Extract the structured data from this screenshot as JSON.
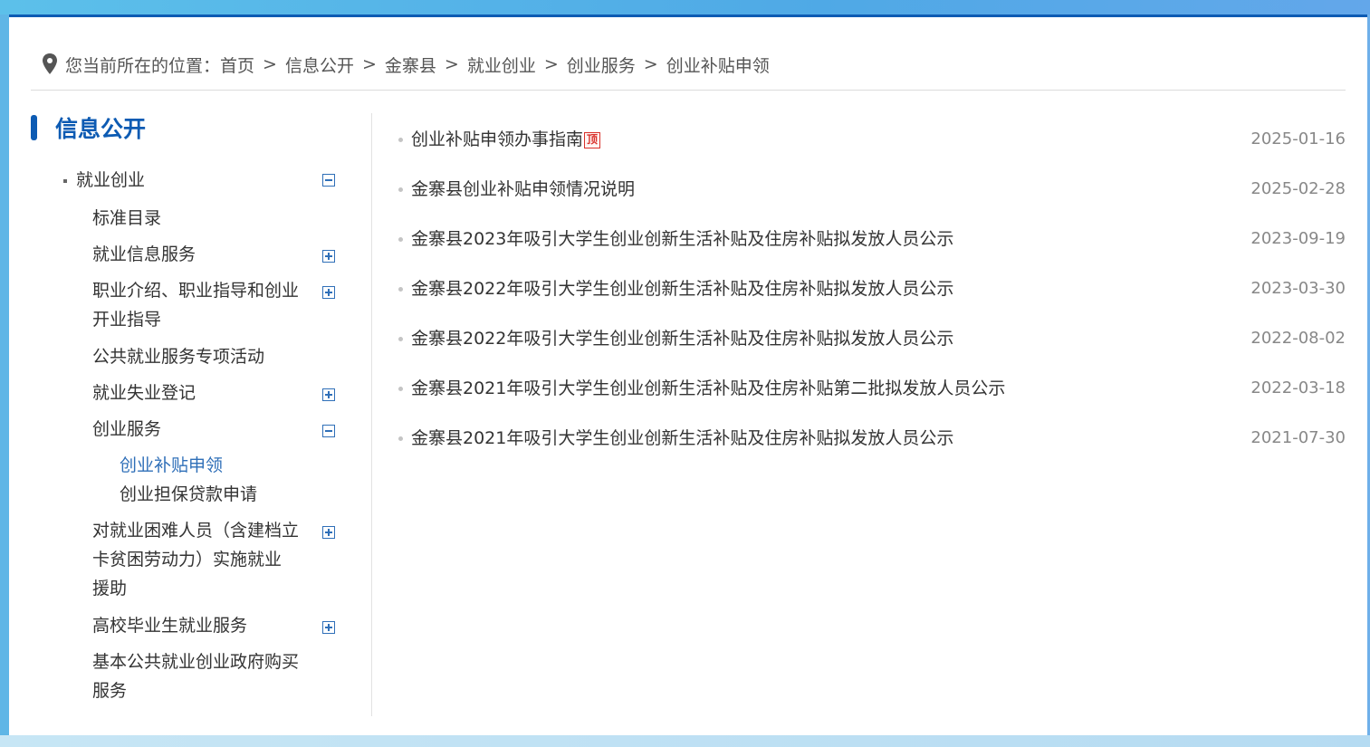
{
  "breadcrumb": {
    "prefix": "您当前所在的位置：",
    "items": [
      "首页",
      "信息公开",
      "金寨县",
      "就业创业",
      "创业服务",
      "创业补贴申领"
    ],
    "separator": ">"
  },
  "sidebar": {
    "title": "信息公开",
    "root": "就业创业",
    "nodes": [
      {
        "label": "标准目录"
      },
      {
        "label": "就业信息服务"
      },
      {
        "label_line1": "职业介绍、职业指导和创业",
        "label_line2": "开业指导"
      },
      {
        "label": "公共就业服务专项活动"
      },
      {
        "label": "就业失业登记"
      },
      {
        "label": "创业服务"
      },
      {
        "label_line1": "对就业困难人员（含建档立",
        "label_line2": "卡贫困劳动力）实施就业",
        "label_line3": "援助"
      },
      {
        "label": "高校毕业生就业服务"
      },
      {
        "label_line1": "基本公共就业创业政府购买",
        "label_line2": "服务"
      }
    ],
    "children": [
      "创业补贴申领",
      "创业担保贷款申请"
    ]
  },
  "list": [
    {
      "title": "创业补贴申领办事指南",
      "badge": "顶",
      "date": "2025-01-16"
    },
    {
      "title": "金寨县创业补贴申领情况说明",
      "date": "2025-02-28"
    },
    {
      "title": "金寨县2023年吸引大学生创业创新生活补贴及住房补贴拟发放人员公示",
      "date": "2023-09-19"
    },
    {
      "title": "金寨县2022年吸引大学生创业创新生活补贴及住房补贴拟发放人员公示",
      "date": "2023-03-30"
    },
    {
      "title": "金寨县2022年吸引大学生创业创新生活补贴及住房补贴拟发放人员公示",
      "date": "2022-08-02"
    },
    {
      "title": "金寨县2021年吸引大学生创业创新生活补贴及住房补贴第二批拟发放人员公示",
      "date": "2022-03-18"
    },
    {
      "title": "金寨县2021年吸引大学生创业创新生活补贴及住房补贴拟发放人员公示",
      "date": "2021-07-30"
    }
  ],
  "colors": {
    "accent": "#0d5bb3",
    "link_active": "#2f6fb8",
    "badge": "#d9312b"
  }
}
